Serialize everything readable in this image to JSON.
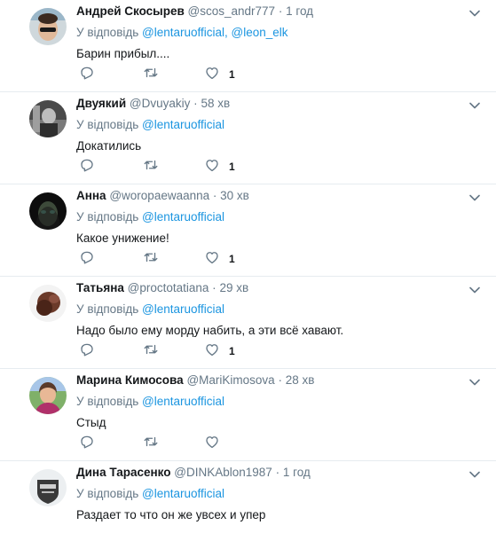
{
  "reply_prefix": "У відповідь",
  "colors": {
    "link": "#1b95e0",
    "muted": "#657786",
    "text": "#14171a",
    "divider": "#e6ecf0"
  },
  "icons": {
    "reply": "reply-icon",
    "retweet": "retweet-icon",
    "like": "heart-icon",
    "menu": "chevron-down-icon"
  },
  "tweets": [
    {
      "name": "Андрей Скосырев",
      "handle": "@scos_andr777",
      "dot": "·",
      "time": "1 год",
      "mentions": "@lentaruofficial, @leon_elk",
      "text": "Барин прибыл....",
      "likes": "1"
    },
    {
      "name": "Двуякий",
      "handle": "@Dvuyakiy",
      "dot": "·",
      "time": "58 хв",
      "mentions": "@lentaruofficial",
      "text": "Докатились",
      "likes": "1"
    },
    {
      "name": "Анна",
      "handle": "@woropaewaanna",
      "dot": "·",
      "time": "30 хв",
      "mentions": "@lentaruofficial",
      "text": "Какое унижение!",
      "likes": "1"
    },
    {
      "name": "Татьяна",
      "handle": "@proctotatiana",
      "dot": "·",
      "time": "29 хв",
      "mentions": "@lentaruofficial",
      "text": "Надо было ему морду набить, а эти всё хавают.",
      "likes": "1"
    },
    {
      "name": "Марина Кимосова",
      "handle": "@MariKimosova",
      "dot": "·",
      "time": "28 хв",
      "mentions": "@lentaruofficial",
      "text": "Стыд",
      "likes": ""
    },
    {
      "name": "Дина Тарасенко",
      "handle": "@DINKAblon1987",
      "dot": "·",
      "time": "1 год",
      "mentions": "@lentaruofficial",
      "text": "Раздает то что он же увсех и упер",
      "likes": ""
    }
  ]
}
